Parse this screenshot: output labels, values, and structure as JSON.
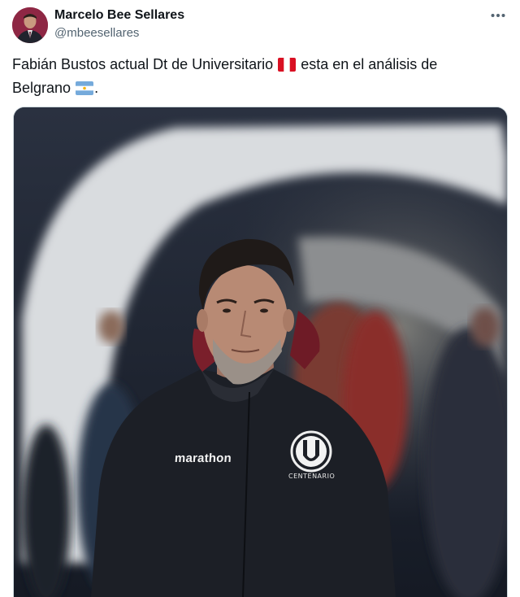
{
  "author": {
    "name": "Marcelo Bee Sellares",
    "handle": "@mbeesellares"
  },
  "tweet": {
    "text_part1": "Fabián Bustos actual Dt de Universitario",
    "text_part2": "esta en el análisis de",
    "text_part3": "Belgrano",
    "text_part4": ".",
    "flag_1": "peru-flag-icon",
    "flag_2": "argentina-flag-icon"
  },
  "media": {
    "jacket_brand": "marathon",
    "crest_text": "CENTENARIO"
  },
  "icons": {
    "more": "more-options-icon"
  },
  "colors": {
    "text": "#0f1419",
    "secondary": "#536471",
    "avatar_bg": "#8e2744"
  }
}
